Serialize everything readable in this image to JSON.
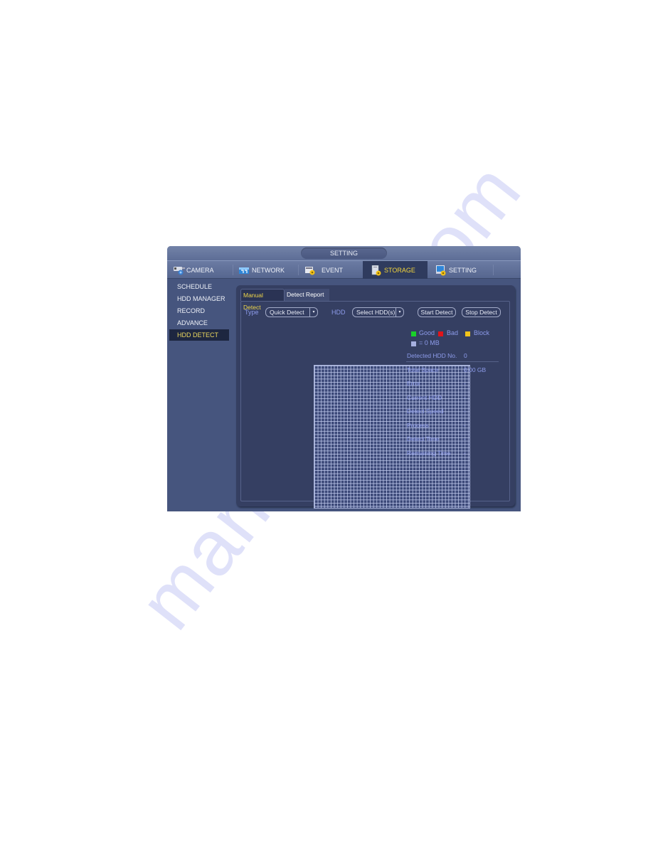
{
  "window": {
    "title": "SETTING"
  },
  "main_tabs": [
    {
      "label": "CAMERA",
      "icon": "camera-icon",
      "active": false
    },
    {
      "label": "NETWORK",
      "icon": "network-icon",
      "active": false
    },
    {
      "label": "EVENT",
      "icon": "event-icon",
      "active": false
    },
    {
      "label": "STORAGE",
      "icon": "storage-icon",
      "active": true
    },
    {
      "label": "SETTING",
      "icon": "setting-icon",
      "active": false
    }
  ],
  "sidebar": {
    "items": [
      {
        "label": "SCHEDULE",
        "active": false
      },
      {
        "label": "HDD MANAGER",
        "active": false
      },
      {
        "label": "RECORD",
        "active": false
      },
      {
        "label": "ADVANCE",
        "active": false
      },
      {
        "label": "HDD DETECT",
        "active": true
      }
    ]
  },
  "sub_tabs": [
    {
      "label": "Manual Detect",
      "active": true
    },
    {
      "label": "Detect Report",
      "active": false
    }
  ],
  "toolbar": {
    "type_label": "Type",
    "type_value": "Quick Detect",
    "hdd_label": "HDD",
    "hdd_value": "Select HDD(s)",
    "dropdown_arrow": "▾",
    "start_label": "Start Detect",
    "stop_label": "Stop Detect"
  },
  "legend": {
    "items": [
      {
        "label": "Good",
        "color": "#19d12a"
      },
      {
        "label": "Bad",
        "color": "#e0141a"
      },
      {
        "label": "Block",
        "color": "#f2c41a"
      }
    ],
    "unit_color": "#a6b0e0",
    "unit_label": "= 0 MB"
  },
  "info": [
    {
      "label": "Detected HDD No.",
      "value": "0"
    },
    {
      "label": "Total Space",
      "value": "0.00 GB"
    },
    {
      "label": "Error",
      "value": "-"
    },
    {
      "label": "Current HDD",
      "value": "-"
    },
    {
      "label": "Detect Speed",
      "value": "-"
    },
    {
      "label": "Process",
      "value": "-"
    },
    {
      "label": "Detect Time",
      "value": "-"
    },
    {
      "label": "Remaining Time",
      "value": "-"
    }
  ],
  "watermark": "manualslib.com"
}
